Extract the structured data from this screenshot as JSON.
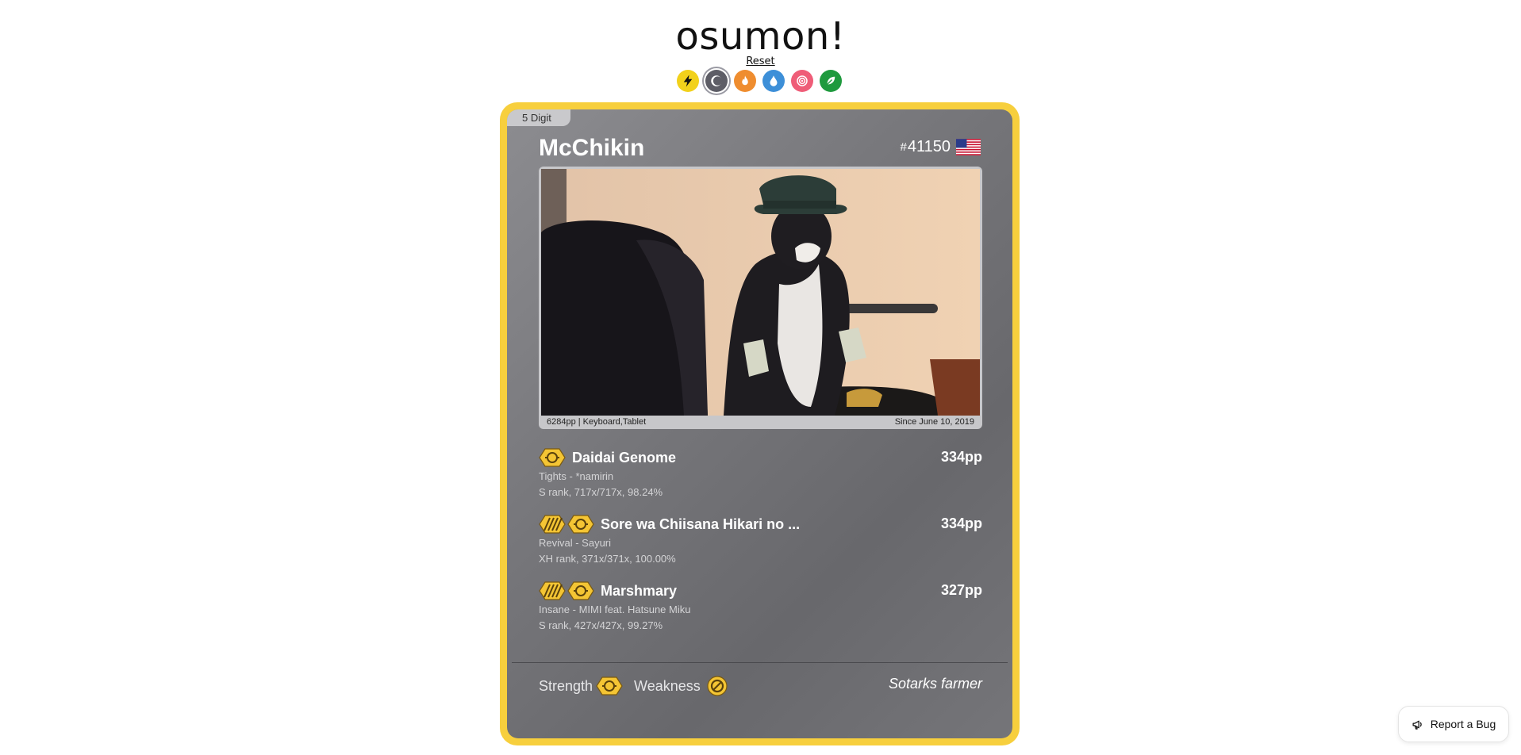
{
  "app": {
    "title": "osumon!",
    "reset_label": "Reset"
  },
  "types": [
    {
      "icon": "lightning-icon",
      "color": "#f2d11b"
    },
    {
      "icon": "moon-icon",
      "color": "#5d5d66",
      "selected": true
    },
    {
      "icon": "fire-icon",
      "color": "#ef8d2f"
    },
    {
      "icon": "water-drop-icon",
      "color": "#3d8fd8"
    },
    {
      "icon": "psychic-swirl-icon",
      "color": "#ef5d78"
    },
    {
      "icon": "leaf-icon",
      "color": "#1f9a3e"
    }
  ],
  "card": {
    "border_color": "#f7cf3d",
    "rarity": "5 Digit",
    "name": "McChikin",
    "rank_hash": "#",
    "rank": "41150",
    "country_icon": "us-flag-icon",
    "photo_left": "6284pp | Keyboard,Tablet",
    "photo_right": "Since June 10, 2019",
    "scores": [
      {
        "title": "Daidai Genome",
        "pp": "334pp",
        "subtitle": "Tights - *namirin",
        "details": "S rank, 717x/717x, 98.24%",
        "mods": [
          "dt-mod-icon"
        ]
      },
      {
        "title": "Sore wa Chiisana Hikari no ...",
        "pp": "334pp",
        "subtitle": "Revival - Sayuri",
        "details": "XH rank, 371x/371x, 100.00%",
        "mods": [
          "hd-mod-icon",
          "dt-mod-icon"
        ]
      },
      {
        "title": "Marshmary",
        "pp": "327pp",
        "subtitle": "Insane - MIMI feat. Hatsune Miku",
        "details": "S rank, 427x/427x, 99.27%",
        "mods": [
          "hd-mod-icon",
          "dt-mod-icon"
        ]
      }
    ],
    "strength_label": "Strength",
    "weakness_label": "Weakness",
    "title_label": "Sotarks farmer"
  },
  "report_bug_label": "Report a Bug"
}
